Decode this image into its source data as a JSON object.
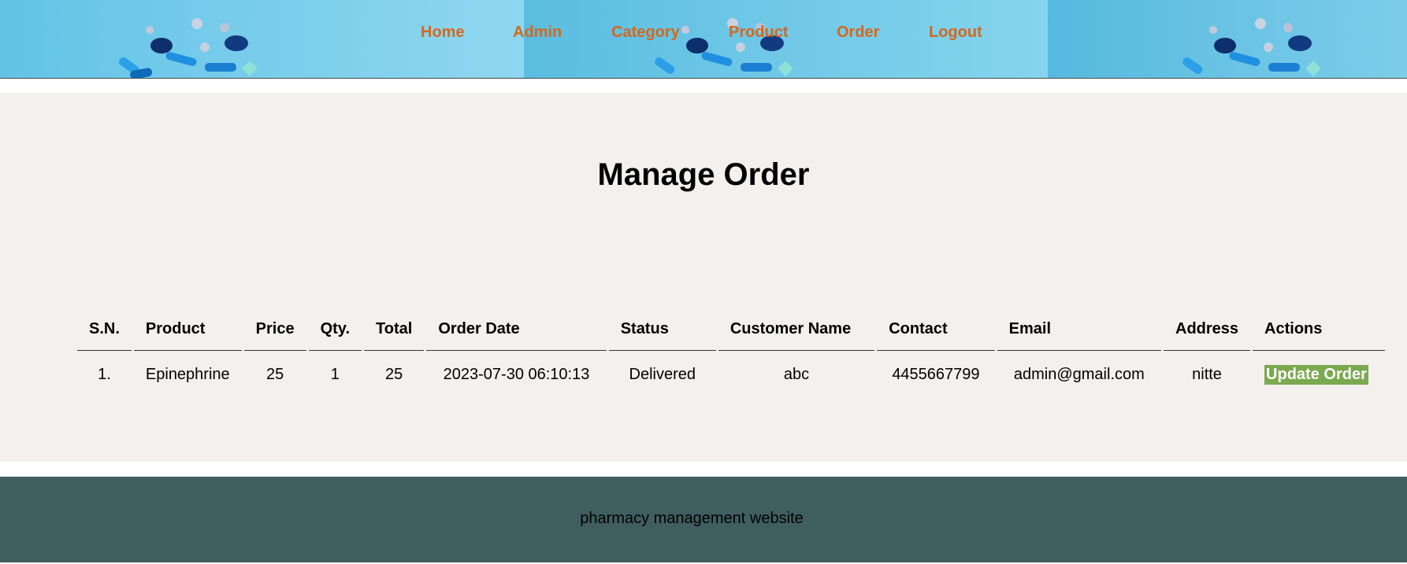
{
  "nav": {
    "items": [
      "Home",
      "Admin",
      "Category",
      "Product",
      "Order",
      "Logout"
    ]
  },
  "main": {
    "title": "Manage Order"
  },
  "table": {
    "headers": [
      "S.N.",
      "Product",
      "Price",
      "Qty.",
      "Total",
      "Order Date",
      "Status",
      "Customer Name",
      "Contact",
      "Email",
      "Address",
      "Actions"
    ],
    "rows": [
      {
        "sn": "1.",
        "product": "Epinephrine",
        "price": "25",
        "qty": "1",
        "total": "25",
        "order_date": "2023-07-30 06:10:13",
        "status": "Delivered",
        "customer_name": "abc",
        "contact": "4455667799",
        "email": "admin@gmail.com",
        "address": "nitte",
        "action_label": "Update Order"
      }
    ]
  },
  "footer": {
    "text": "pharmacy management website"
  },
  "colors": {
    "nav_link": "#d2691e",
    "banner": "#7dcde9",
    "main_bg": "#f3f0ed",
    "status_delivered": "#1c8a1c",
    "action_button": "#7aa94f",
    "footer_bg": "#405e5f"
  }
}
